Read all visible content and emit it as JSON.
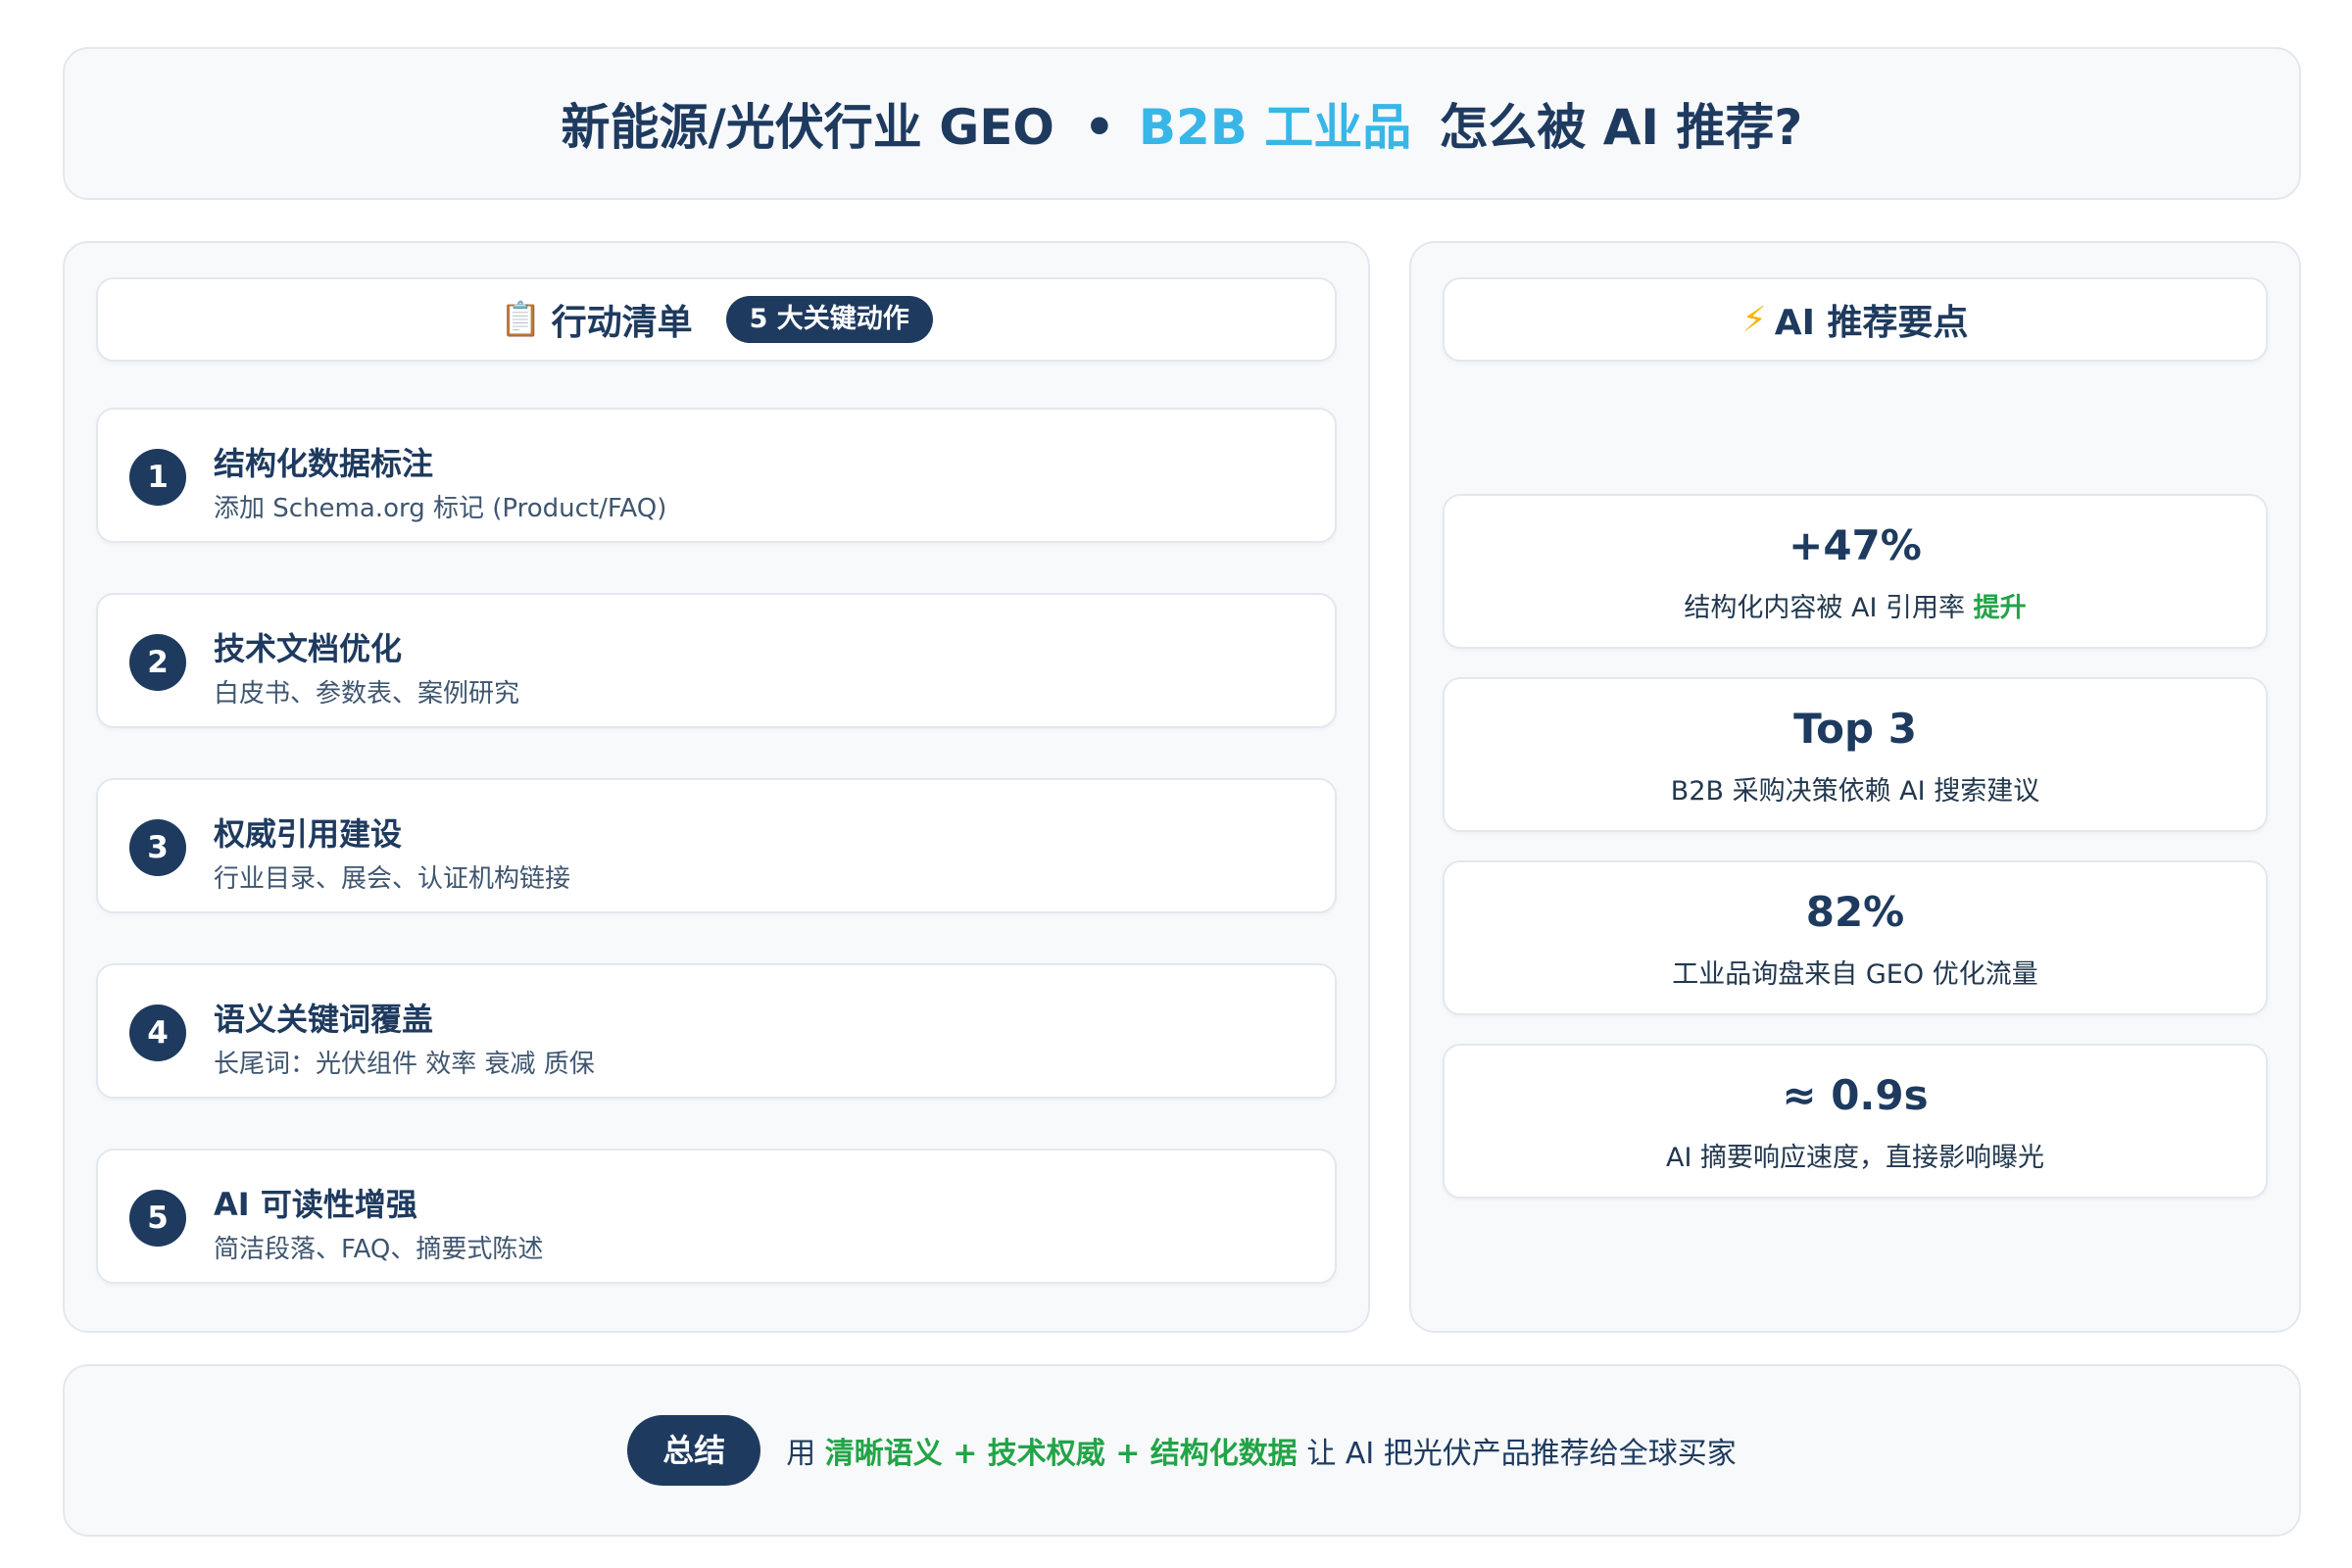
{
  "header": {
    "title_part1": "新能源/光伏行业 GEO",
    "separator": "•",
    "title_accent": "B2B 工业品",
    "title_part2": "怎么被 AI 推荐?"
  },
  "checklist": {
    "icon": "clipboard-icon",
    "title": "行动清单",
    "badge": "5 大关键动作",
    "items": [
      {
        "num": "1",
        "title": "结构化数据标注",
        "desc": "添加 Schema.org 标记 (Product/FAQ)"
      },
      {
        "num": "2",
        "title": "技术文档优化",
        "desc": "白皮书、参数表、案例研究"
      },
      {
        "num": "3",
        "title": "权威引用建设",
        "desc": "行业目录、展会、认证机构链接"
      },
      {
        "num": "4",
        "title": "语义关键词覆盖",
        "desc": "长尾词：光伏组件 效率 衰减 质保"
      },
      {
        "num": "5",
        "title": "AI 可读性增强",
        "desc": "简洁段落、FAQ、摘要式陈述"
      }
    ]
  },
  "highlights": {
    "icon": "lightning-icon",
    "title": "AI 推荐要点",
    "stats": [
      {
        "value": "+47%",
        "desc": "结构化内容被 AI 引用率",
        "desc_highlight": "提升"
      },
      {
        "value": "Top 3",
        "desc": "B2B 采购决策依赖 AI 搜索建议"
      },
      {
        "value": "82%",
        "desc": "工业品询盘来自 GEO 优化流量"
      },
      {
        "value": "≈ 0.9s",
        "desc": "AI 摘要响应速度，直接影响曝光"
      }
    ]
  },
  "summary": {
    "label": "总结",
    "prefix": "用",
    "highlight": "清晰语义 + 技术权威 + 结构化数据",
    "suffix": "让 AI 把光伏产品推荐给全球买家"
  },
  "colors": {
    "primary": "#1e3a5f",
    "accent": "#38b6e8",
    "highlight": "#22a447",
    "panel_bg": "#f7f9fb"
  }
}
